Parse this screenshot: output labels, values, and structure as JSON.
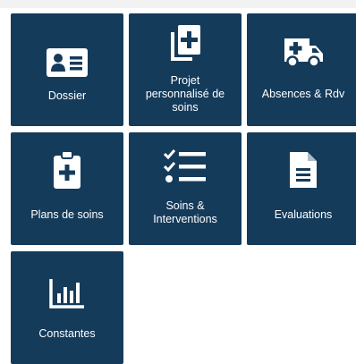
{
  "colors": {
    "tile": "#153b5b",
    "icon": "#ffffff",
    "text": "#ffffff"
  },
  "tiles": [
    {
      "label": "Dossier",
      "icon": "id-card-icon"
    },
    {
      "label": "Projet\npersonnalisé de\nsoins",
      "icon": "copy-plus-icon"
    },
    {
      "label": "Absences & Rdv",
      "icon": "ambulance-icon"
    },
    {
      "label": "Plans de soins",
      "icon": "clipboard-plus-icon"
    },
    {
      "label": "Soins &\nInterventions",
      "icon": "checklist-icon"
    },
    {
      "label": "Evaluations",
      "icon": "document-icon"
    },
    {
      "label": "Constantes",
      "icon": "bar-chart-icon"
    }
  ]
}
